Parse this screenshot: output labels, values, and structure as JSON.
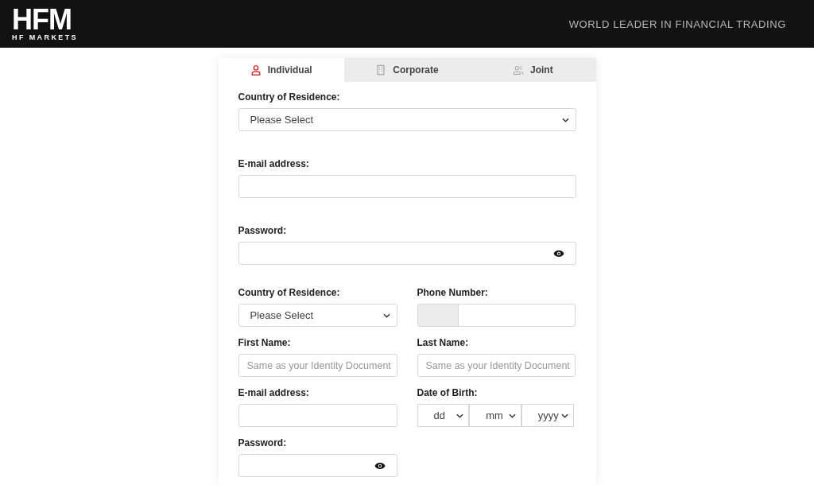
{
  "header": {
    "logo": "HFM",
    "logo_subtitle": "HF MARKETS",
    "tagline": "WORLD LEADER IN FINANCIAL TRADING"
  },
  "tabs": [
    {
      "label": "Individual",
      "kind": "person",
      "selected": true
    },
    {
      "label": "Corporate",
      "kind": "building",
      "selected": false
    },
    {
      "label": "Joint",
      "kind": "people",
      "selected": false
    }
  ],
  "top_fields": [
    {
      "label": "Country of Residence:",
      "kind": "select",
      "value": "Please Select"
    },
    {
      "label": "E-mail address:",
      "kind": "text"
    },
    {
      "label": "Password:",
      "kind": "password"
    }
  ],
  "grid_fields": [
    {
      "label": "Country of Residence:",
      "kind": "select",
      "value": "Please Select"
    },
    {
      "label": "Phone Number:",
      "kind": "phone"
    },
    {
      "label": "First Name:",
      "kind": "text",
      "placeholder": "Same as your Identity Document"
    },
    {
      "label": "Last Name:",
      "kind": "text",
      "placeholder": "Same as your Identity Document"
    },
    {
      "label": "E-mail address:",
      "kind": "text"
    },
    {
      "label": "Date of Birth:",
      "kind": "date",
      "parts": [
        "dd",
        "mm",
        "yyyy"
      ]
    },
    {
      "label": "Password:",
      "kind": "password"
    }
  ]
}
